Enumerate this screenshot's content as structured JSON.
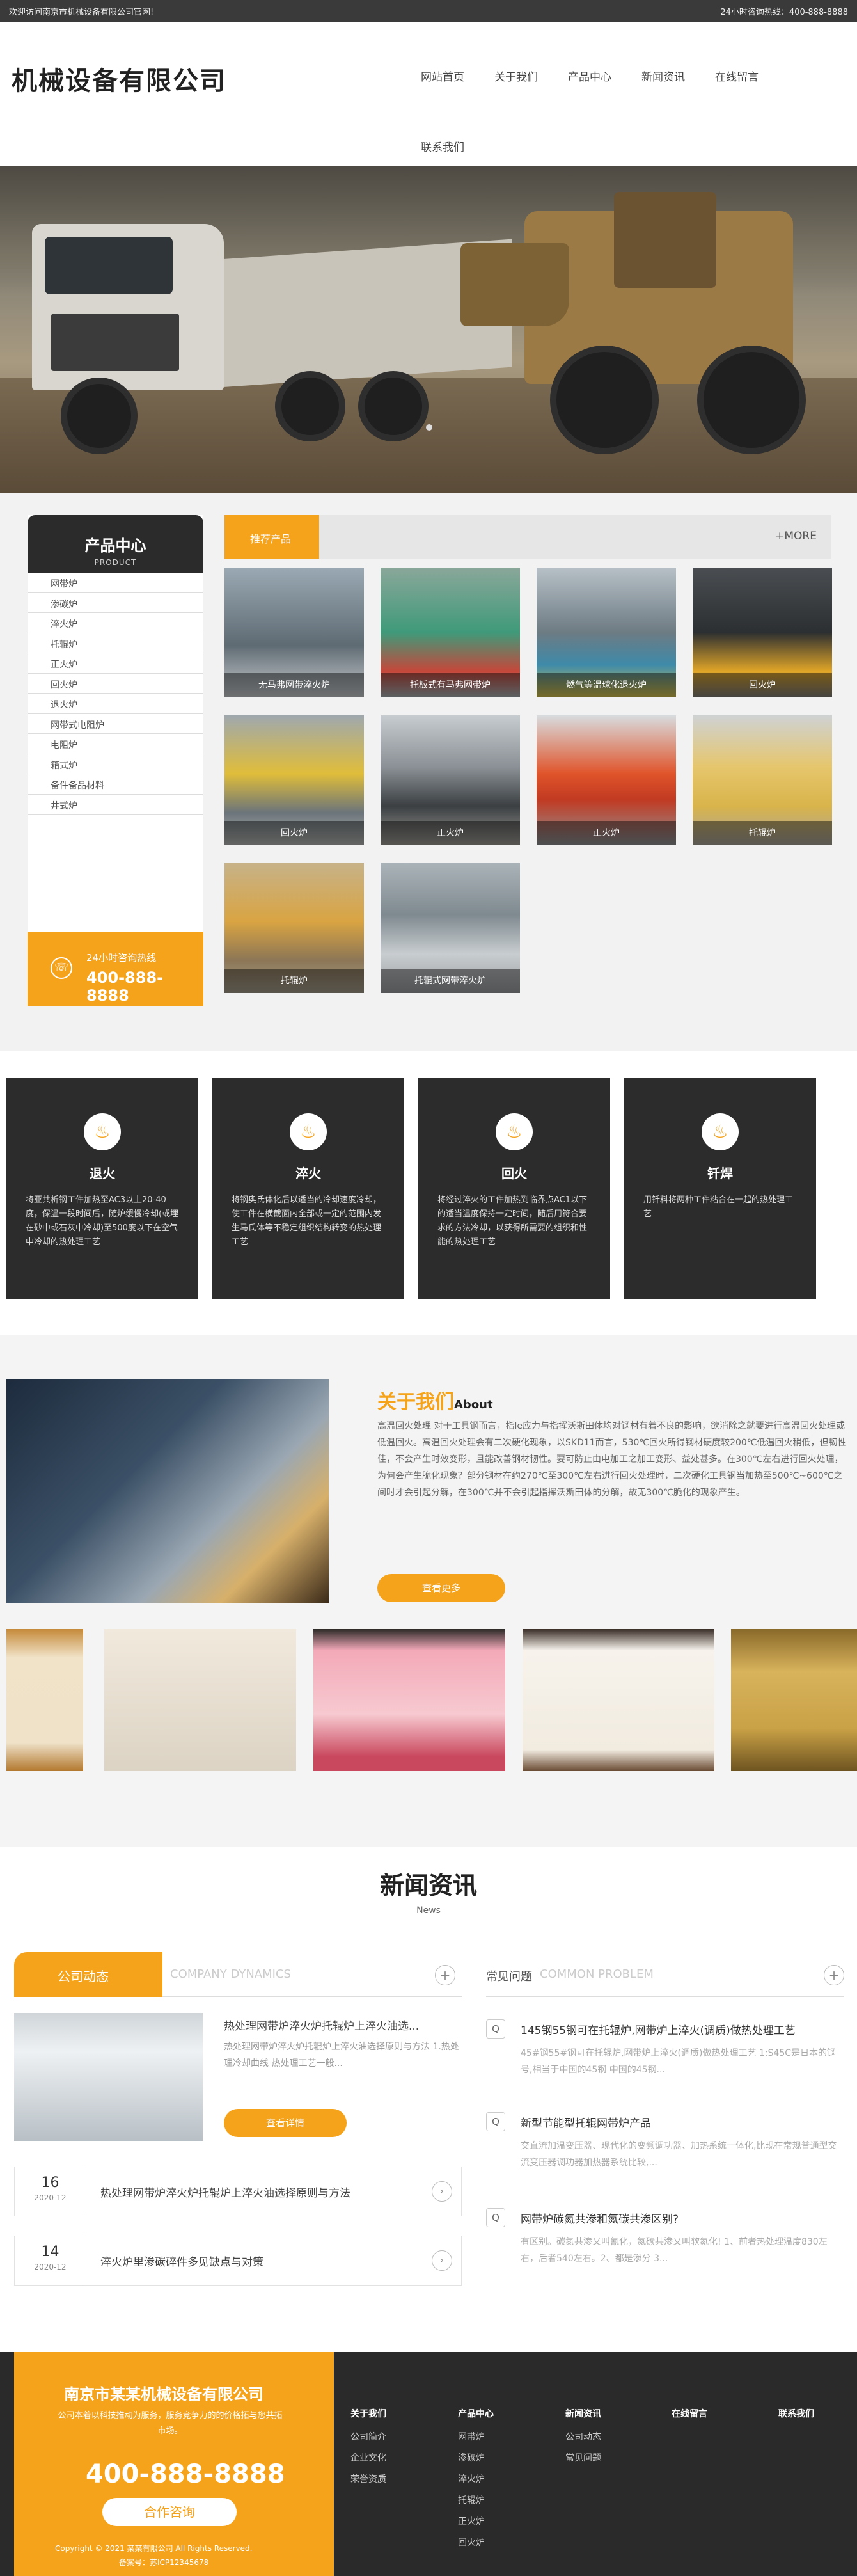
{
  "topbar": {
    "welcome": "欢迎访问南京市机械设备有限公司官网!",
    "hotline": "24小时咨询热线：400-888-8888"
  },
  "header": {
    "logo": "机械设备有限公司",
    "nav": [
      "网站首页",
      "关于我们",
      "产品中心",
      "新闻资讯",
      "在线留言",
      "联系我们"
    ]
  },
  "sidebar": {
    "title": "产品中心",
    "subtitle": "PRODUCT",
    "items": [
      "网带炉",
      "渗碳炉",
      "淬火炉",
      "托辊炉",
      "正火炉",
      "回火炉",
      "退火炉",
      "网带式电阻炉",
      "电阻炉",
      "箱式炉",
      "备件备品材料",
      "井式炉"
    ],
    "hotline_label": "24小时咨询热线",
    "hotline_number": "400-888-8888"
  },
  "products": {
    "tag": "推荐产品",
    "more": "+MORE",
    "items": [
      "无马弗网带淬火炉",
      "托板式有马弗网带炉",
      "燃气等温球化退火炉",
      "回火炉",
      "回火炉",
      "正火炉",
      "正火炉",
      "托辊炉",
      "托辊炉",
      "托辊式网带淬火炉"
    ]
  },
  "processes": [
    {
      "title": "退火",
      "text": "将亚共析钢工件加热至AC3以上20-40度，保温一段时间后，随炉缓慢冷却(或埋在砂中或石灰中冷却)至500度以下在空气中冷却的热处理工艺"
    },
    {
      "title": "淬火",
      "text": "将钢奥氏体化后以适当的冷却速度冷却，使工件在横截面内全部或一定的范围内发生马氏体等不稳定组织结构转变的热处理工艺"
    },
    {
      "title": "回火",
      "text": "将经过淬火的工件加热到临界点AC1以下的适当温度保持一定时间，随后用符合要求的方法冷却，以获得所需要的组织和性能的热处理工艺"
    },
    {
      "title": "钎焊",
      "text": "用钎料将两种工件粘合在一起的热处理工艺"
    }
  ],
  "about": {
    "title": "关于我们",
    "title_en": "About",
    "text": "高温回火处理 对于工具钢而言，指le应力与指挥沃斯田体均对钢材有着不良的影响，欲消除之就要进行高温回火处理或低温回火。高温回火处理会有二次硬化现象，以SKD11而言，530℃回火所得钢材硬度较200℃低温回火稍低，但韧性佳，不会产生时效变形，且能改善钢材韧性。要可防止由电加工之加工变形、益处甚多。在300℃左右进行回火处理，为何会产生脆化现象？部分钢材在约270℃至300℃左右进行回火处理时，二次硬化工具钢当加热至500℃~600℃之间时才会引起分解，在300℃并不会引起指挥沃斯田体的分解，故无300℃脆化的现象产生。",
    "button": "查看更多"
  },
  "news": {
    "title": "新闻资讯",
    "subtitle": "News",
    "company_tab": "公司动态",
    "company_tab_en": "COMPANY DYNAMICS",
    "faq_tab": "常见问题",
    "faq_tab_en": "COMMON PROBLEM",
    "featured_title": "热处理网带炉淬火炉托辊炉上淬火油选...",
    "featured_desc": "热处理网带炉淬火炉托辊炉上淬火油选择原则与方法 1.热处理冷却曲线 热处理工艺一般...",
    "featured_button": "查看详情",
    "rows": [
      {
        "day": "16",
        "ym": "2020-12",
        "title": "热处理网带炉淬火炉托辊炉上淬火油选择原则与方法"
      },
      {
        "day": "14",
        "ym": "2020-12",
        "title": "淬火炉里渗碳碎件多见缺点与对策"
      }
    ],
    "faq": [
      {
        "q": "145钢55钢可在托辊炉,网带炉上淬火(调质)做热处理工艺",
        "a": "45#钢55#钢可在托辊炉,网带炉上淬火(调质)做热处理工艺 1;S45C是日本的钢号,相当于中国的45钢 中国的45钢..."
      },
      {
        "q": "新型节能型托辊网带炉产品",
        "a": "交直流加温变压器、现代化的变频调功器、加热系统一体化,比现在常规普通型交流变压器调功器加热器系统比较,..."
      },
      {
        "q": "网带炉碳氮共渗和氮碳共渗区别?",
        "a": "有区别。碳氮共渗又叫氰化，氮碳共渗又叫软氮化! 1、前者热处理温度830左右，后者540左右。2、都是渗分 3..."
      }
    ]
  },
  "footer": {
    "company": "南京市某某机械设备有限公司",
    "desc": "公司本着以科技推动为服务，服务竞争力的的价格拓与您共拓市场。",
    "phone": "400-888-8888",
    "consult": "合作咨询",
    "copyright": "Copyright © 2021 某某有限公司 All Rights Reserved.",
    "icp": "备案号：苏ICP12345678",
    "columns": [
      {
        "title": "关于我们",
        "items": [
          "公司简介",
          "企业文化",
          "荣誉资质"
        ]
      },
      {
        "title": "产品中心",
        "items": [
          "网带炉",
          "渗碳炉",
          "淬火炉",
          "托辊炉",
          "正火炉",
          "回火炉"
        ]
      },
      {
        "title": "新闻资讯",
        "items": [
          "公司动态",
          "常见问题"
        ]
      },
      {
        "title": "在线留言",
        "items": []
      },
      {
        "title": "联系我们",
        "items": []
      }
    ]
  },
  "colors": {
    "accent": "#f6a31c",
    "dark": "#2b2b2b"
  }
}
